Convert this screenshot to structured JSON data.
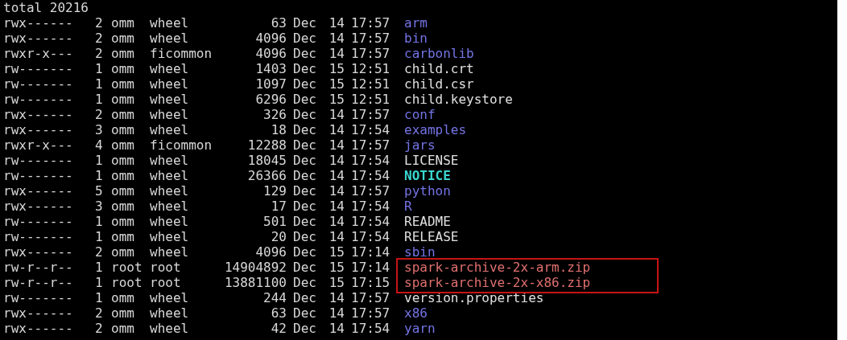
{
  "terminal": {
    "summary": "total 20216",
    "rows": [
      {
        "perms": "rwx------",
        "links": "2",
        "owner": "omm",
        "group": "wheel",
        "size": "63",
        "month": "Dec",
        "day": "14",
        "time": "17:57",
        "name": "arm",
        "kind": "dir",
        "highlighted": false
      },
      {
        "perms": "rwx------",
        "links": "2",
        "owner": "omm",
        "group": "wheel",
        "size": "4096",
        "month": "Dec",
        "day": "14",
        "time": "17:57",
        "name": "bin",
        "kind": "dir",
        "highlighted": false
      },
      {
        "perms": "rwxr-x---",
        "links": "2",
        "owner": "omm",
        "group": "ficommon",
        "size": "4096",
        "month": "Dec",
        "day": "14",
        "time": "17:57",
        "name": "carbonlib",
        "kind": "dir",
        "highlighted": false
      },
      {
        "perms": "rw-------",
        "links": "1",
        "owner": "omm",
        "group": "wheel",
        "size": "1403",
        "month": "Dec",
        "day": "15",
        "time": "12:51",
        "name": "child.crt",
        "kind": "file",
        "highlighted": false
      },
      {
        "perms": "rw-------",
        "links": "1",
        "owner": "omm",
        "group": "wheel",
        "size": "1097",
        "month": "Dec",
        "day": "15",
        "time": "12:51",
        "name": "child.csr",
        "kind": "file",
        "highlighted": false
      },
      {
        "perms": "rw-------",
        "links": "1",
        "owner": "omm",
        "group": "wheel",
        "size": "6296",
        "month": "Dec",
        "day": "15",
        "time": "12:51",
        "name": "child.keystore",
        "kind": "file",
        "highlighted": false
      },
      {
        "perms": "rwx------",
        "links": "2",
        "owner": "omm",
        "group": "wheel",
        "size": "326",
        "month": "Dec",
        "day": "14",
        "time": "17:57",
        "name": "conf",
        "kind": "dir",
        "highlighted": false
      },
      {
        "perms": "rwx------",
        "links": "3",
        "owner": "omm",
        "group": "wheel",
        "size": "18",
        "month": "Dec",
        "day": "14",
        "time": "17:54",
        "name": "examples",
        "kind": "dir",
        "highlighted": false
      },
      {
        "perms": "rwxr-x---",
        "links": "4",
        "owner": "omm",
        "group": "ficommon",
        "size": "12288",
        "month": "Dec",
        "day": "14",
        "time": "17:57",
        "name": "jars",
        "kind": "dir",
        "highlighted": false
      },
      {
        "perms": "rw-------",
        "links": "1",
        "owner": "omm",
        "group": "wheel",
        "size": "18045",
        "month": "Dec",
        "day": "14",
        "time": "17:54",
        "name": "LICENSE",
        "kind": "file",
        "highlighted": false
      },
      {
        "perms": "rw-------",
        "links": "1",
        "owner": "omm",
        "group": "wheel",
        "size": "26366",
        "month": "Dec",
        "day": "14",
        "time": "17:54",
        "name": "NOTICE",
        "kind": "exec",
        "highlighted": false
      },
      {
        "perms": "rwx------",
        "links": "5",
        "owner": "omm",
        "group": "wheel",
        "size": "129",
        "month": "Dec",
        "day": "14",
        "time": "17:57",
        "name": "python",
        "kind": "dir",
        "highlighted": false
      },
      {
        "perms": "rwx------",
        "links": "3",
        "owner": "omm",
        "group": "wheel",
        "size": "17",
        "month": "Dec",
        "day": "14",
        "time": "17:54",
        "name": "R",
        "kind": "dir",
        "highlighted": false
      },
      {
        "perms": "rw-------",
        "links": "1",
        "owner": "omm",
        "group": "wheel",
        "size": "501",
        "month": "Dec",
        "day": "14",
        "time": "17:54",
        "name": "README",
        "kind": "file",
        "highlighted": false
      },
      {
        "perms": "rw-------",
        "links": "1",
        "owner": "omm",
        "group": "wheel",
        "size": "20",
        "month": "Dec",
        "day": "14",
        "time": "17:54",
        "name": "RELEASE",
        "kind": "file",
        "highlighted": false
      },
      {
        "perms": "rwx------",
        "links": "2",
        "owner": "omm",
        "group": "wheel",
        "size": "4096",
        "month": "Dec",
        "day": "15",
        "time": "17:14",
        "name": "sbin",
        "kind": "dir",
        "highlighted": false
      },
      {
        "perms": "rw-r--r--",
        "links": "1",
        "owner": "root",
        "group": "root",
        "size": "14904892",
        "month": "Dec",
        "day": "15",
        "time": "17:14",
        "name": "spark-archive-2x-arm.zip",
        "kind": "archive",
        "highlighted": true
      },
      {
        "perms": "rw-r--r--",
        "links": "1",
        "owner": "root",
        "group": "root",
        "size": "13881100",
        "month": "Dec",
        "day": "15",
        "time": "17:15",
        "name": "spark-archive-2x-x86.zip",
        "kind": "archive",
        "highlighted": true
      },
      {
        "perms": "rw-------",
        "links": "1",
        "owner": "omm",
        "group": "wheel",
        "size": "244",
        "month": "Dec",
        "day": "14",
        "time": "17:57",
        "name": "version.properties",
        "kind": "file",
        "highlighted": false
      },
      {
        "perms": "rwx------",
        "links": "2",
        "owner": "omm",
        "group": "wheel",
        "size": "63",
        "month": "Dec",
        "day": "14",
        "time": "17:57",
        "name": "x86",
        "kind": "dir",
        "highlighted": false
      },
      {
        "perms": "rwx------",
        "links": "2",
        "owner": "omm",
        "group": "wheel",
        "size": "42",
        "month": "Dec",
        "day": "14",
        "time": "17:54",
        "name": "yarn",
        "kind": "dir",
        "highlighted": false
      }
    ]
  }
}
